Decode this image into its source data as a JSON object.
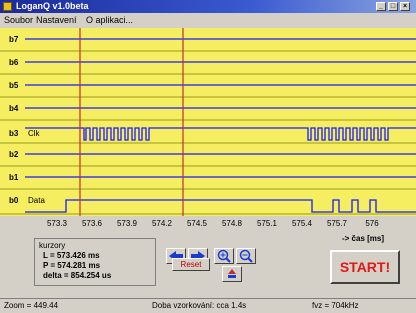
{
  "window": {
    "title": "LoganQ v1.0beta"
  },
  "menu": {
    "items": [
      "Soubor",
      "Nastavení",
      "O aplikaci..."
    ]
  },
  "lanes": [
    {
      "label": "b7"
    },
    {
      "label": "b6"
    },
    {
      "label": "b5"
    },
    {
      "label": "b4"
    },
    {
      "label": "b3",
      "name": "Clk"
    },
    {
      "label": "b2"
    },
    {
      "label": "b1"
    },
    {
      "label": "b0",
      "name": "Data"
    }
  ],
  "axis": {
    "ticks": [
      "573.3",
      "573.6",
      "573.9",
      "574.2",
      "574.5",
      "574.8",
      "575.1",
      "575.4",
      "575.7",
      "576"
    ],
    "unit": "-> čas [ms]"
  },
  "cursors": {
    "title": "kurzory",
    "L": "L    = 573.426 ms",
    "P": "P    = 574.281 ms",
    "delta": "delta = 854.254 us",
    "line_color": "#c03030"
  },
  "controls": {
    "reset_label": "Reset",
    "start_label": "START!"
  },
  "status": {
    "zoom": "Zoom = 449.44",
    "sampling": "Doba vzorkování: cca 1.4s",
    "freq": "fvz = 704kHz"
  },
  "colors": {
    "background": "#f4ee60",
    "signal": "#1a1aff",
    "cursor": "#c03030",
    "start": "#e01818"
  }
}
